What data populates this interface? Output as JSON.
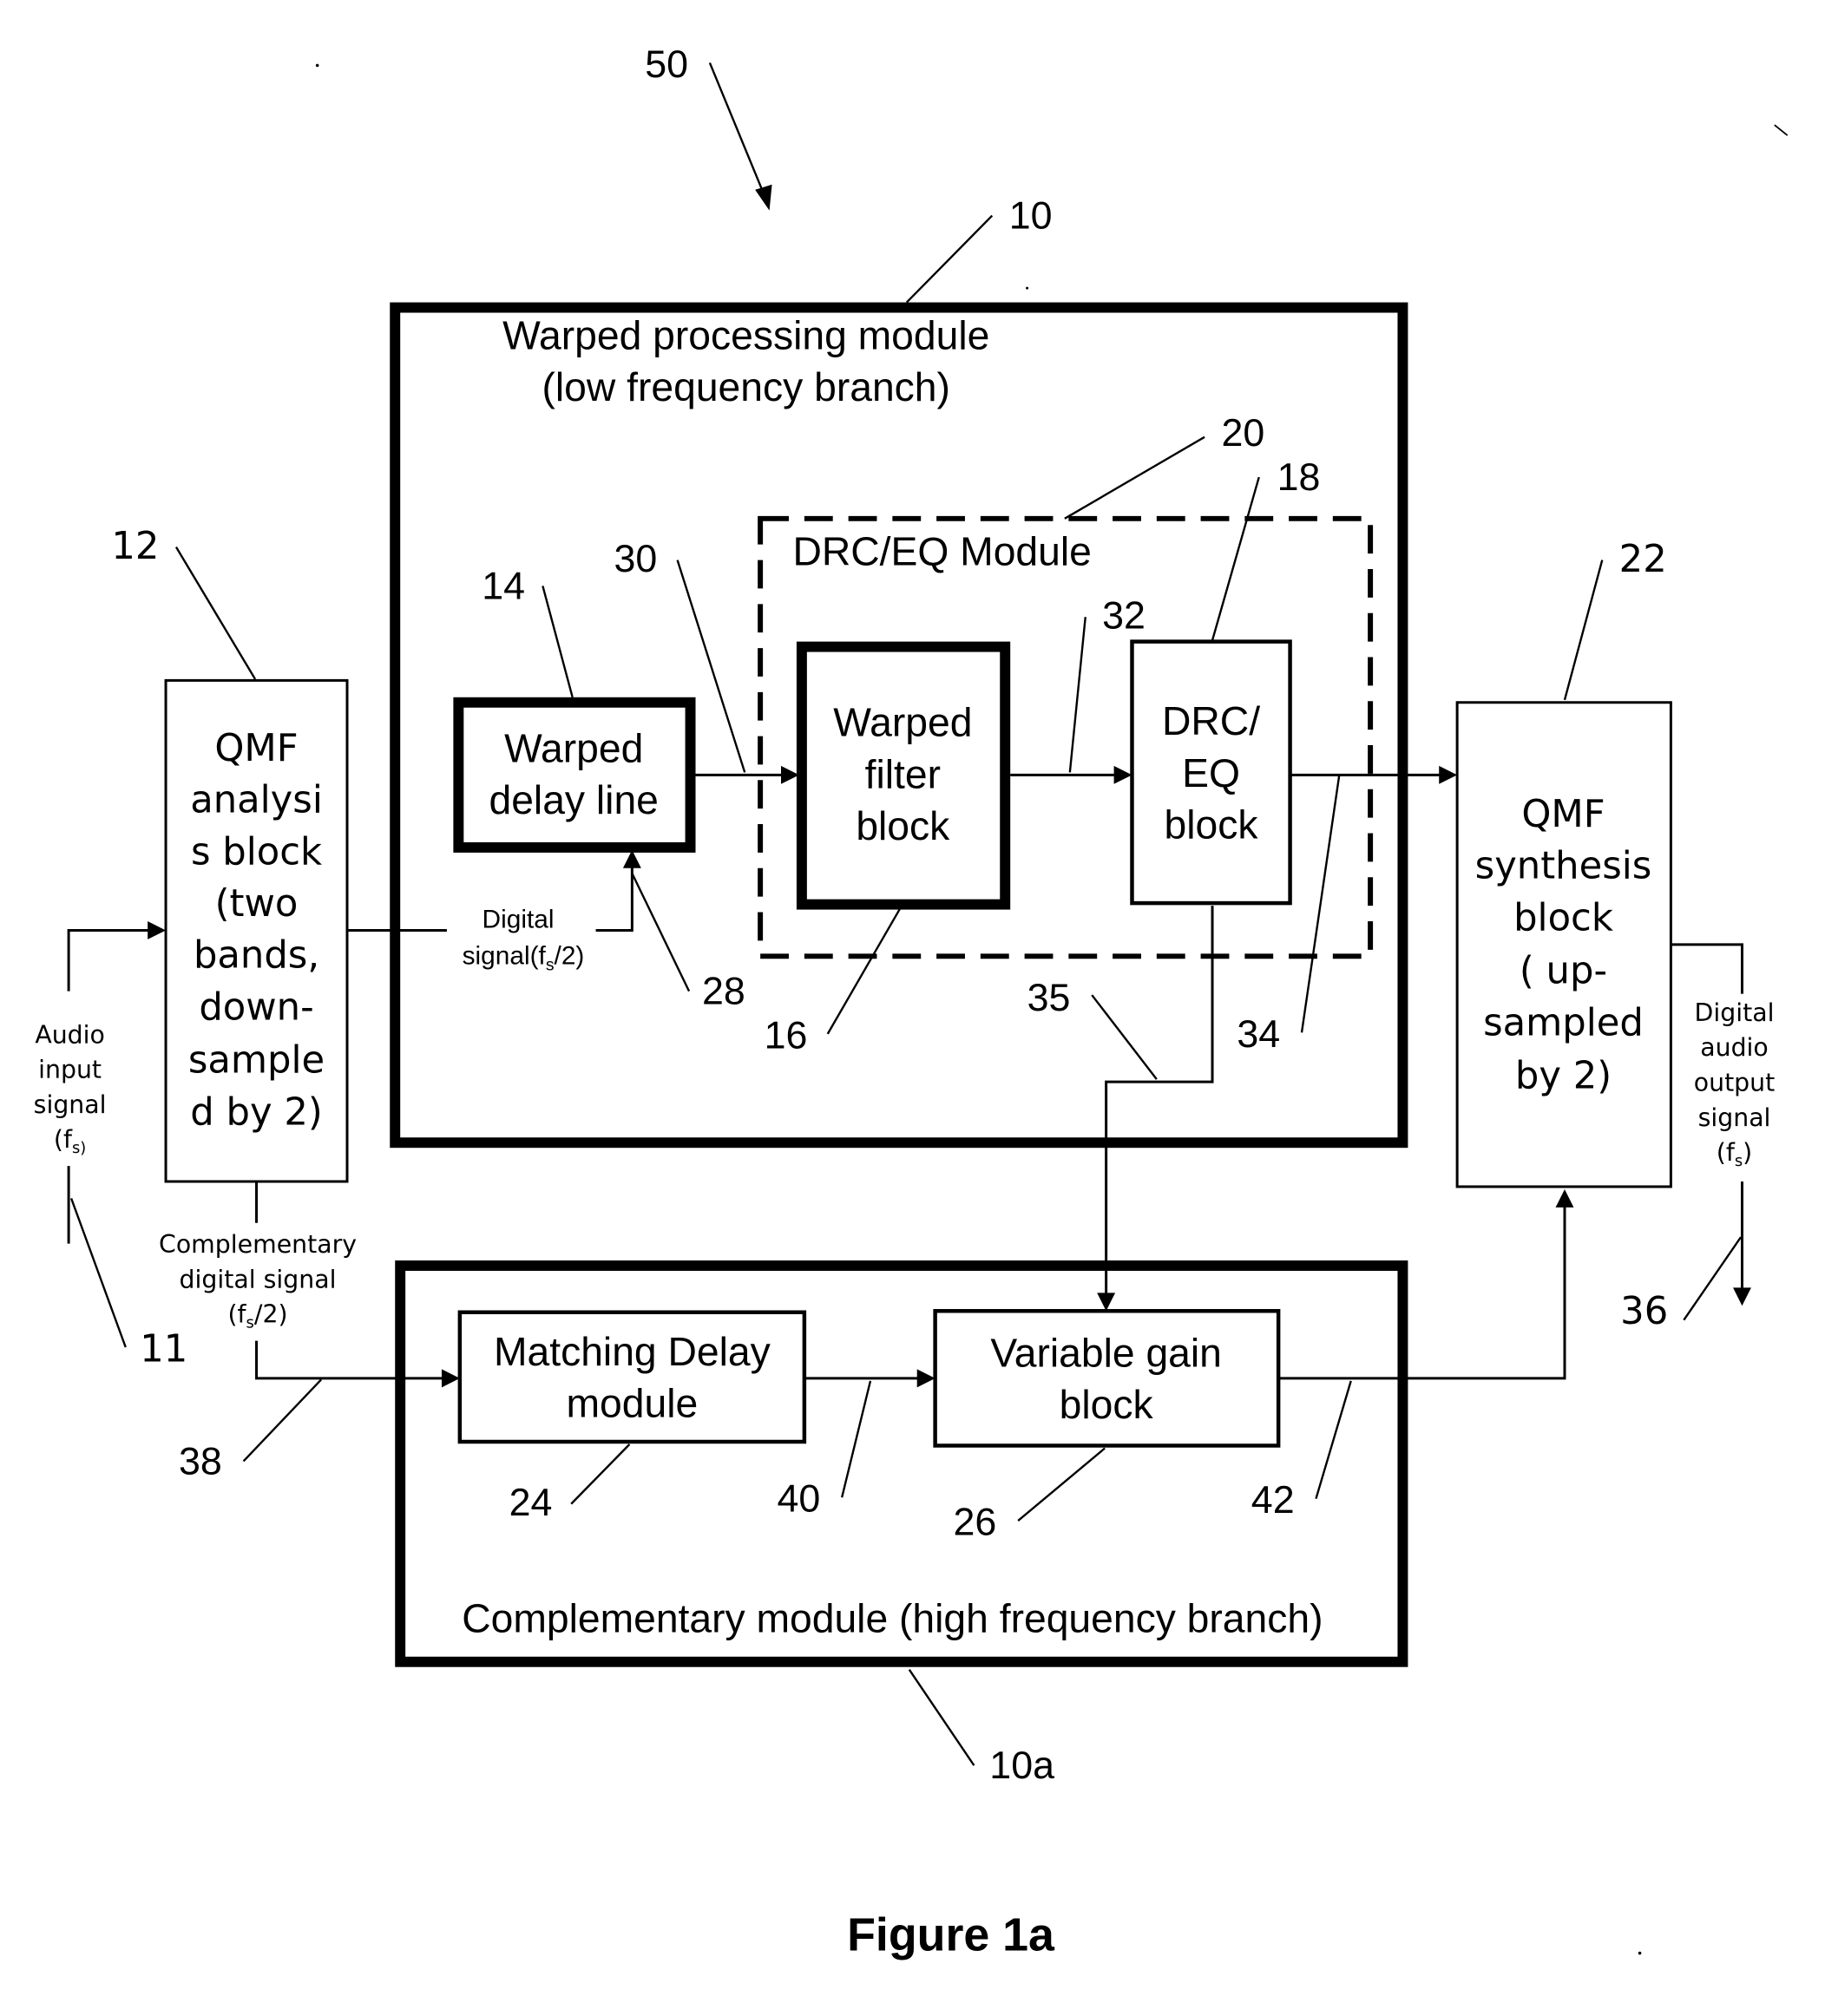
{
  "figure": {
    "caption": "Figure 1a",
    "ref_system": "50"
  },
  "modules": {
    "warped_processing": {
      "ref": "10",
      "title_line1": "Warped processing module",
      "title_line2": "(low frequency branch)"
    },
    "drc_eq_module": {
      "ref": "20",
      "title": "DRC/EQ Module"
    },
    "complementary": {
      "ref": "10a",
      "title": "Complementary module (high frequency branch)"
    }
  },
  "blocks": {
    "qmf_analysis": {
      "ref": "12",
      "lines": [
        "QMF",
        "analysi",
        "s block",
        "(two",
        "bands,",
        "down-",
        "sample",
        "d by 2)"
      ]
    },
    "warped_delay_line": {
      "ref": "14",
      "lines": [
        "Warped",
        "delay line"
      ]
    },
    "warped_filter": {
      "ref": "16",
      "lines": [
        "Warped",
        "filter",
        "block"
      ]
    },
    "drc_eq_block": {
      "ref": "18",
      "lines": [
        "DRC/",
        "EQ",
        "block"
      ]
    },
    "qmf_synthesis": {
      "ref": "22",
      "lines": [
        "QMF",
        "synthesis",
        "block",
        "( up-",
        "sampled",
        "by 2)"
      ]
    },
    "matching_delay": {
      "ref": "24",
      "lines": [
        "Matching Delay",
        "module"
      ]
    },
    "variable_gain": {
      "ref": "26",
      "lines": [
        "Variable gain",
        "block"
      ]
    }
  },
  "signals": {
    "audio_input": {
      "ref": "11",
      "lines": [
        "Audio",
        "input",
        "signal"
      ],
      "rate_prefix": "(f",
      "rate_sub": "s)",
      "rate_suffix": ""
    },
    "digital_signal": {
      "ref": "28",
      "line1": "Digital",
      "line2_prefix": "signal(f",
      "line2_sub": "s",
      "line2_suffix": "/2)"
    },
    "complementary_digital": {
      "ref": "38",
      "lines": [
        "Complementary",
        "digital signal"
      ],
      "rate_prefix": "(f",
      "rate_sub": "s",
      "rate_suffix": "/2)"
    },
    "digital_audio_output": {
      "ref": "36",
      "lines": [
        "Digital",
        "audio",
        "output",
        "signal"
      ],
      "rate_prefix": "(f",
      "rate_sub": "s",
      "rate_suffix": ")"
    },
    "delay_to_filter": {
      "ref": "30"
    },
    "filter_to_drc": {
      "ref": "32"
    },
    "drc_to_synthesis": {
      "ref": "34"
    },
    "gain_control": {
      "ref": "35"
    },
    "delay_to_gain": {
      "ref": "40"
    },
    "gain_to_synthesis": {
      "ref": "42"
    }
  }
}
